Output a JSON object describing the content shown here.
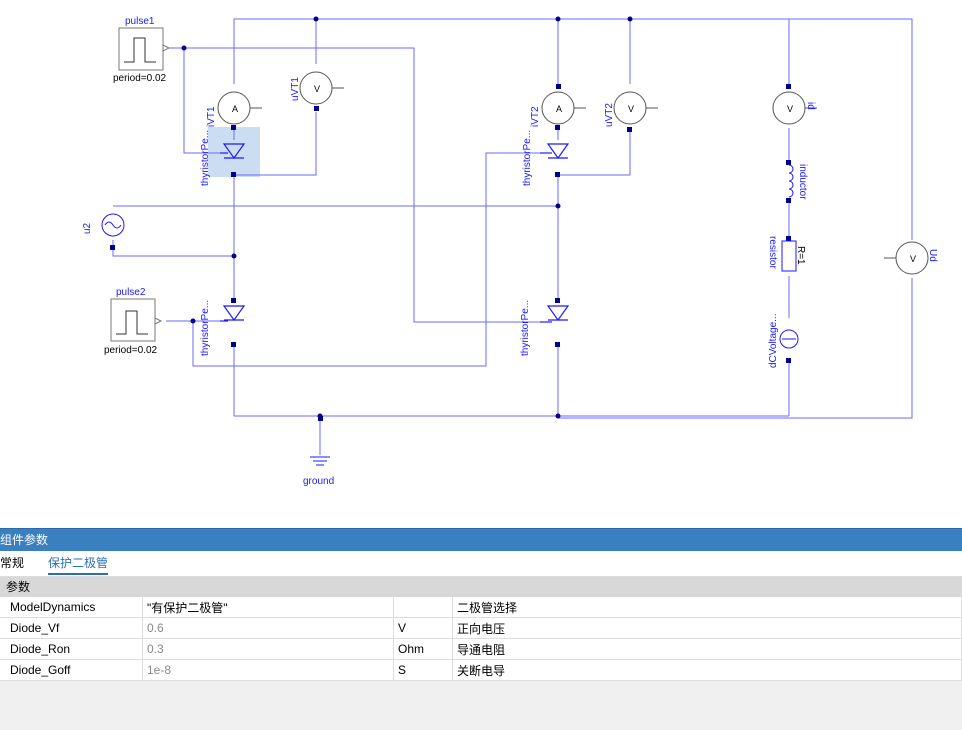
{
  "diagram": {
    "labels": {
      "pulse1": "pulse1",
      "pulse1_period": "period=0.02",
      "pulse2": "pulse2",
      "pulse2_period": "period=0.02",
      "iVT1": "iVT1",
      "uVT1": "uVT1",
      "iVT2": "iVT2",
      "uVT2": "uVT2",
      "id": "id",
      "thy1": "thyristorPe...",
      "thy2": "thyristorPe...",
      "thy3": "thyristorPe...",
      "thy4": "thyristorPe...",
      "u2": "u2",
      "inductor": "inductor",
      "resistor": "resistor",
      "resistor_value": "R=1",
      "dcvoltage": "dCVoltage...",
      "ud": "Ud",
      "ground": "ground"
    },
    "colors": {
      "wire": "#5a5aff",
      "component": "#1a1aff",
      "selection": "#a9c8e8"
    }
  },
  "panel": {
    "title": "组件参数",
    "tabs": [
      "常规",
      "保护二极管"
    ],
    "active_tab": "保护二极管",
    "section": "参数",
    "rows": [
      {
        "name": "ModelDynamics",
        "value": "\"有保护二极管\"",
        "unit": "",
        "desc": "二极管选择"
      },
      {
        "name": "Diode_Vf",
        "value": "0.6",
        "unit": "V",
        "desc": "正向电压"
      },
      {
        "name": "Diode_Ron",
        "value": "0.3",
        "unit": "Ohm",
        "desc": "导通电阻"
      },
      {
        "name": "Diode_Goff",
        "value": "1e-8",
        "unit": "S",
        "desc": "关断电导"
      }
    ]
  }
}
